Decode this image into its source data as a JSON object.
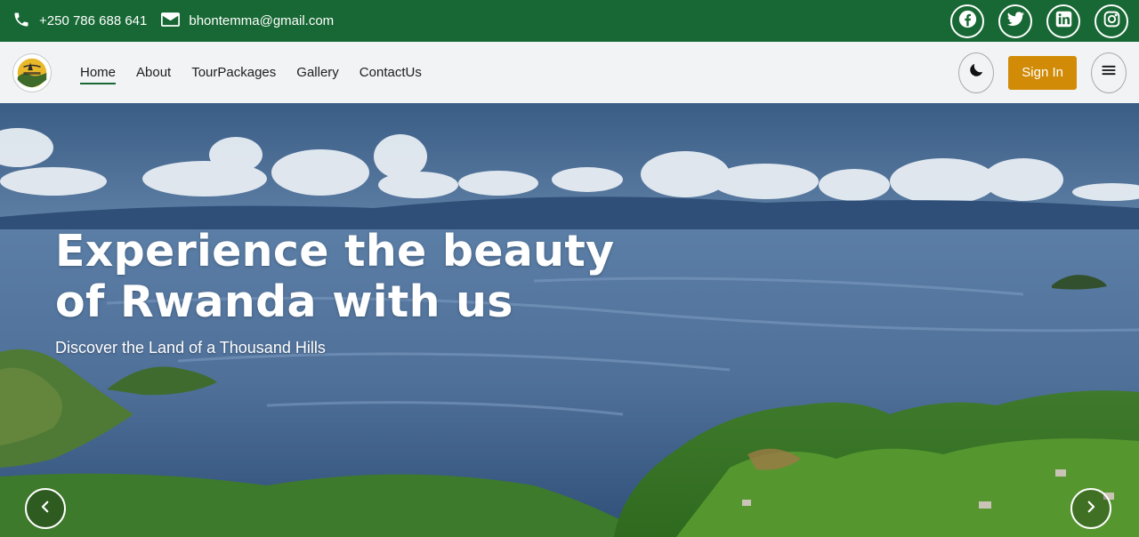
{
  "topbar": {
    "phone": "+250 786 688 641",
    "email": "bhontemma@gmail.com",
    "socials": [
      {
        "icon": "facebook-icon"
      },
      {
        "icon": "twitter-icon"
      },
      {
        "icon": "linkedin-icon"
      },
      {
        "icon": "instagram-icon"
      }
    ],
    "color": "#176834"
  },
  "navbar": {
    "links": [
      {
        "label": "Home",
        "active": true
      },
      {
        "label": "About"
      },
      {
        "label": "TourPackages"
      },
      {
        "label": "Gallery"
      },
      {
        "label": "ContactUs"
      }
    ],
    "theme_toggle_icon": "moon-icon",
    "signin_label": "Sign In",
    "menu_icon": "hamburger-menu-icon",
    "signin_color": "#d18b07"
  },
  "hero": {
    "title": "Experience the beauty of Rwanda with us",
    "subtitle": "Discover the Land of a Thousand Hills",
    "prev_icon": "chevron-left-icon",
    "next_icon": "chevron-right-icon"
  }
}
